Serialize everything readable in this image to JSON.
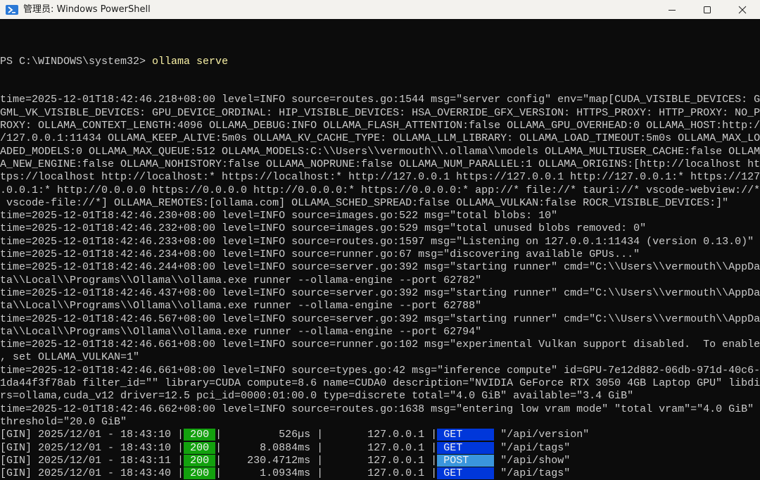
{
  "window": {
    "title": "管理员: Windows PowerShell",
    "icon": "powershell-icon"
  },
  "prompt": {
    "text": "PS C:\\WINDOWS\\system32> ",
    "command": "ollama serve"
  },
  "log_lines": [
    "time=2025-12-01T18:42:46.218+08:00 level=INFO source=routes.go:1544 msg=\"server config\" env=\"map[CUDA_VISIBLE_DEVICES: G",
    "GML_VK_VISIBLE_DEVICES: GPU_DEVICE_ORDINAL: HIP_VISIBLE_DEVICES: HSA_OVERRIDE_GFX_VERSION: HTTPS_PROXY: HTTP_PROXY: NO_P",
    "ROXY: OLLAMA_CONTEXT_LENGTH:4096 OLLAMA_DEBUG:INFO OLLAMA_FLASH_ATTENTION:false OLLAMA_GPU_OVERHEAD:0 OLLAMA_HOST:http:/",
    "/127.0.0.1:11434 OLLAMA_KEEP_ALIVE:5m0s OLLAMA_KV_CACHE_TYPE: OLLAMA_LLM_LIBRARY: OLLAMA_LOAD_TIMEOUT:5m0s OLLAMA_MAX_LO",
    "ADED_MODELS:0 OLLAMA_MAX_QUEUE:512 OLLAMA_MODELS:C:\\\\Users\\\\vermouth\\\\.ollama\\\\models OLLAMA_MULTIUSER_CACHE:false OLLAM",
    "A_NEW_ENGINE:false OLLAMA_NOHISTORY:false OLLAMA_NOPRUNE:false OLLAMA_NUM_PARALLEL:1 OLLAMA_ORIGINS:[http://localhost ht",
    "tps://localhost http://localhost:* https://localhost:* http://127.0.0.1 https://127.0.0.1 http://127.0.0.1:* https://127",
    ".0.0.1:* http://0.0.0.0 https://0.0.0.0 http://0.0.0.0:* https://0.0.0.0:* app://* file://* tauri://* vscode-webview://*",
    " vscode-file://*] OLLAMA_REMOTES:[ollama.com] OLLAMA_SCHED_SPREAD:false OLLAMA_VULKAN:false ROCR_VISIBLE_DEVICES:]\"",
    "time=2025-12-01T18:42:46.230+08:00 level=INFO source=images.go:522 msg=\"total blobs: 10\"",
    "time=2025-12-01T18:42:46.232+08:00 level=INFO source=images.go:529 msg=\"total unused blobs removed: 0\"",
    "time=2025-12-01T18:42:46.233+08:00 level=INFO source=routes.go:1597 msg=\"Listening on 127.0.0.1:11434 (version 0.13.0)\"",
    "time=2025-12-01T18:42:46.234+08:00 level=INFO source=runner.go:67 msg=\"discovering available GPUs...\"",
    "time=2025-12-01T18:42:46.244+08:00 level=INFO source=server.go:392 msg=\"starting runner\" cmd=\"C:\\\\Users\\\\vermouth\\\\AppDa",
    "ta\\\\Local\\\\Programs\\\\Ollama\\\\ollama.exe runner --ollama-engine --port 62782\"",
    "time=2025-12-01T18:42:46.437+08:00 level=INFO source=server.go:392 msg=\"starting runner\" cmd=\"C:\\\\Users\\\\vermouth\\\\AppDa",
    "ta\\\\Local\\\\Programs\\\\Ollama\\\\ollama.exe runner --ollama-engine --port 62788\"",
    "time=2025-12-01T18:42:46.567+08:00 level=INFO source=server.go:392 msg=\"starting runner\" cmd=\"C:\\\\Users\\\\vermouth\\\\AppDa",
    "ta\\\\Local\\\\Programs\\\\Ollama\\\\ollama.exe runner --ollama-engine --port 62794\"",
    "time=2025-12-01T18:42:46.661+08:00 level=INFO source=runner.go:102 msg=\"experimental Vulkan support disabled.  To enable",
    ", set OLLAMA_VULKAN=1\"",
    "time=2025-12-01T18:42:46.661+08:00 level=INFO source=types.go:42 msg=\"inference compute\" id=GPU-7e12d882-06db-971d-40c6-",
    "1da44f3f78ab filter_id=\"\" library=CUDA compute=8.6 name=CUDA0 description=\"NVIDIA GeForce RTX 3050 4GB Laptop GPU\" libdi",
    "rs=ollama,cuda_v12 driver=12.5 pci_id=0000:01:00.0 type=discrete total=\"4.0 GiB\" available=\"3.4 GiB\"",
    "time=2025-12-01T18:42:46.662+08:00 level=INFO source=routes.go:1638 msg=\"entering low vram mode\" \"total vram\"=\"4.0 GiB\"",
    "threshold=\"20.0 GiB\""
  ],
  "gin_rows": [
    {
      "prefix": "[GIN] 2025/12/01 - 18:43:10 ",
      "status": " 200 ",
      "latency": "        526µs",
      "ip": "      127.0.0.1",
      "method": " GET     ",
      "method_style": "blue",
      "path": "\"/api/version\""
    },
    {
      "prefix": "[GIN] 2025/12/01 - 18:43:10 ",
      "status": " 200 ",
      "latency": "     8.0884ms",
      "ip": "      127.0.0.1",
      "method": " GET     ",
      "method_style": "blue",
      "path": "\"/api/tags\""
    },
    {
      "prefix": "[GIN] 2025/12/01 - 18:43:11 ",
      "status": " 200 ",
      "latency": "   230.4712ms",
      "ip": "      127.0.0.1",
      "method": " POST    ",
      "method_style": "cyan",
      "path": "\"/api/show\""
    },
    {
      "prefix": "[GIN] 2025/12/01 - 18:43:40 ",
      "status": " 200 ",
      "latency": "     1.0934ms",
      "ip": "      127.0.0.1",
      "method": " GET     ",
      "method_style": "blue",
      "path": "\"/api/tags\""
    }
  ],
  "colors": {
    "background": "#0c0c0c",
    "text": "#cccccc",
    "command": "#f9f1a5",
    "status_ok": "#13a10e",
    "method_get": "#0037da",
    "method_post": "#3a96dd"
  }
}
